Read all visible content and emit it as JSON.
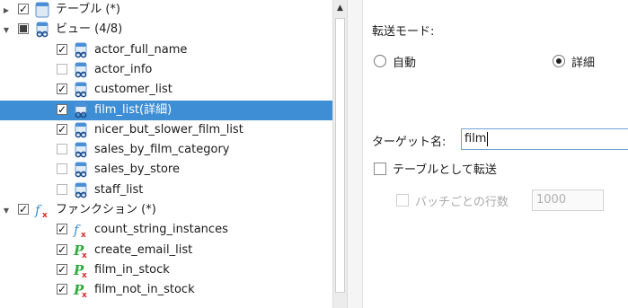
{
  "tree": {
    "items": [
      {
        "label": "テーブル (*)",
        "icon": "table-icon",
        "expander": "collapsed",
        "check": "checked",
        "level": 0
      },
      {
        "label": "ビュー (4/8)",
        "icon": "view-icon",
        "expander": "expanded",
        "check": "partial",
        "level": 0
      },
      {
        "label": "actor_full_name",
        "icon": "view-icon",
        "check": "checked",
        "level": 1
      },
      {
        "label": "actor_info",
        "icon": "view-icon",
        "check": "unchecked",
        "level": 1
      },
      {
        "label": "customer_list",
        "icon": "view-icon",
        "check": "checked",
        "level": 1
      },
      {
        "label": "film_list(詳細)",
        "icon": "view-icon",
        "check": "checked",
        "level": 1,
        "selected": true
      },
      {
        "label": "nicer_but_slower_film_list",
        "icon": "view-icon",
        "check": "checked",
        "level": 1
      },
      {
        "label": "sales_by_film_category",
        "icon": "view-icon",
        "check": "unchecked",
        "level": 1
      },
      {
        "label": "sales_by_store",
        "icon": "view-icon",
        "check": "unchecked",
        "level": 1
      },
      {
        "label": "staff_list",
        "icon": "view-icon",
        "check": "unchecked",
        "level": 1
      },
      {
        "label": "ファンクション (*)",
        "icon": "function-icon",
        "expander": "expanded",
        "check": "checked",
        "level": 0
      },
      {
        "label": "count_string_instances",
        "icon": "function-icon",
        "check": "checked",
        "level": 1
      },
      {
        "label": "create_email_list",
        "icon": "procedure-icon",
        "check": "checked",
        "level": 1
      },
      {
        "label": "film_in_stock",
        "icon": "procedure-icon",
        "check": "checked",
        "level": 1
      },
      {
        "label": "film_not_in_stock",
        "icon": "procedure-icon",
        "check": "checked",
        "level": 1
      }
    ]
  },
  "settings": {
    "transfer_mode_label": "転送モード:",
    "mode_auto_label": "自動",
    "mode_detail_label": "詳細",
    "mode_selected": "detail",
    "target_name_label": "ターゲット名:",
    "target_name_value": "film",
    "transfer_as_table_label": "テーブルとして転送",
    "transfer_as_table_checked": false,
    "rows_per_batch_label": "バッチごとの行数",
    "rows_per_batch_value": "1000",
    "rows_per_batch_enabled": false
  },
  "colors": {
    "selection": "#3d8ed4",
    "view_icon_top": "#4a90d9",
    "function_icon": "#3a8fd6",
    "procedure_icon": "#2eaa3c",
    "icon_x": "#d62828"
  }
}
